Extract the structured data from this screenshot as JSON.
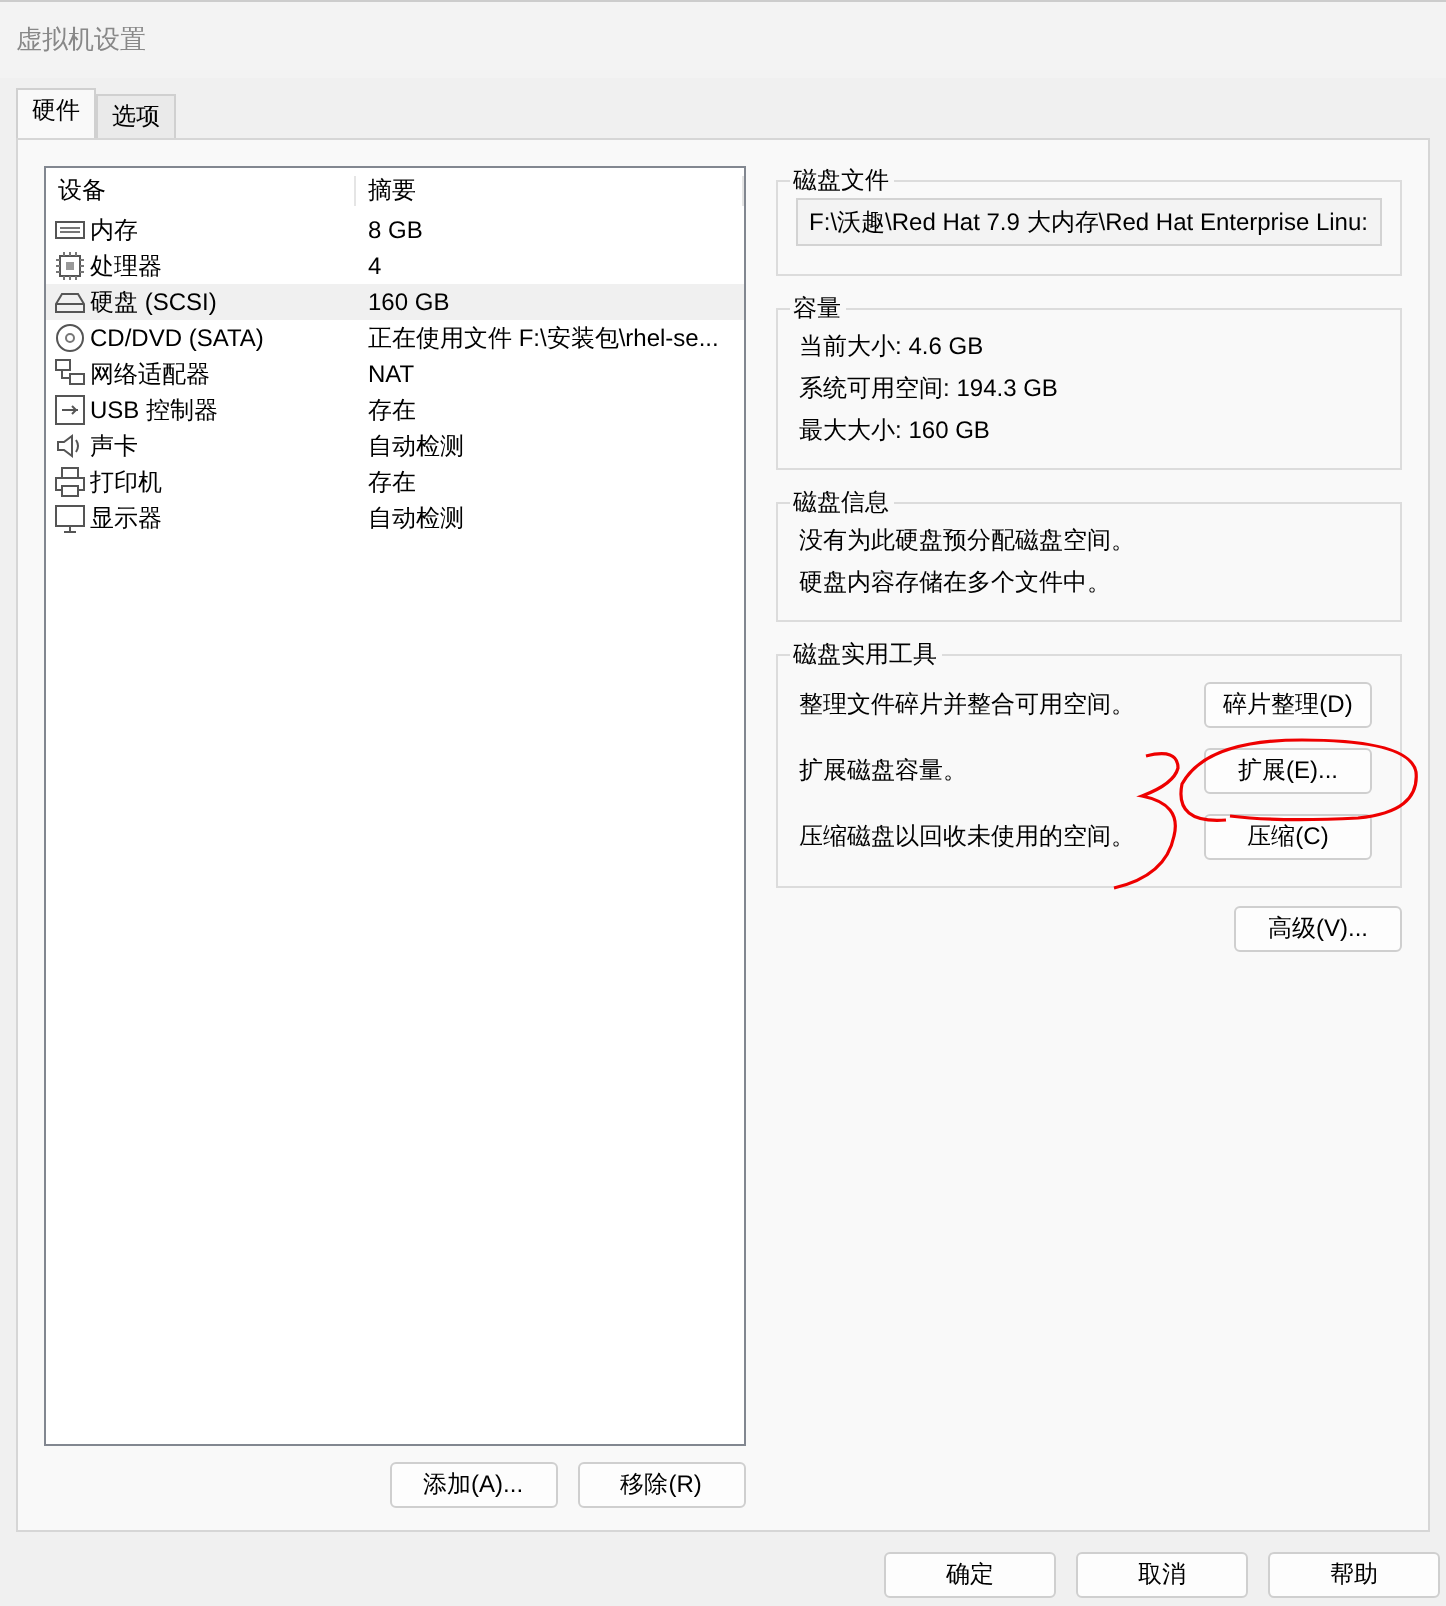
{
  "window": {
    "title": "虚拟机设置"
  },
  "tabs": [
    {
      "label": "硬件",
      "selected": true
    },
    {
      "label": "选项",
      "selected": false
    }
  ],
  "devices": {
    "columns": [
      "设备",
      "摘要"
    ],
    "rows": [
      {
        "kind": "memory",
        "name": "内存",
        "summary": "8 GB",
        "selected": false
      },
      {
        "kind": "cpu",
        "name": "处理器",
        "summary": "4",
        "selected": false
      },
      {
        "kind": "disk",
        "name": "硬盘 (SCSI)",
        "summary": "160 GB",
        "selected": true
      },
      {
        "kind": "cd",
        "name": "CD/DVD (SATA)",
        "summary": "正在使用文件 F:\\安装包\\rhel-se...",
        "selected": false
      },
      {
        "kind": "network",
        "name": "网络适配器",
        "summary": "NAT",
        "selected": false
      },
      {
        "kind": "usb",
        "name": "USB 控制器",
        "summary": "存在",
        "selected": false
      },
      {
        "kind": "sound",
        "name": "声卡",
        "summary": "自动检测",
        "selected": false
      },
      {
        "kind": "printer",
        "name": "打印机",
        "summary": "存在",
        "selected": false
      },
      {
        "kind": "display",
        "name": "显示器",
        "summary": "自动检测",
        "selected": false
      }
    ]
  },
  "list_buttons": [
    "添加(A)...",
    "移除(R)"
  ],
  "disk_file": {
    "title": "磁盘文件",
    "path": "F:\\沃趣\\Red Hat 7.9 大内存\\Red Hat Enterprise Linu:"
  },
  "capacity": {
    "title": "容量",
    "lines": [
      "当前大小: 4.6 GB",
      "系统可用空间: 194.3 GB",
      "最大大小: 160 GB"
    ]
  },
  "disk_info": {
    "title": "磁盘信息",
    "lines": [
      "没有为此硬盘预分配磁盘空间。",
      "硬盘内容存储在多个文件中。"
    ]
  },
  "utilities": {
    "title": "磁盘实用工具",
    "rows": [
      {
        "text": "整理文件碎片并整合可用空间。",
        "button": "碎片整理(D)"
      },
      {
        "text": "扩展磁盘容量。",
        "button": "扩展(E)..."
      },
      {
        "text": "压缩磁盘以回收未使用的空间。",
        "button": "压缩(C)"
      }
    ]
  },
  "advanced_button": "高级(V)...",
  "dialog_buttons": [
    "确定",
    "取消",
    "帮助"
  ]
}
